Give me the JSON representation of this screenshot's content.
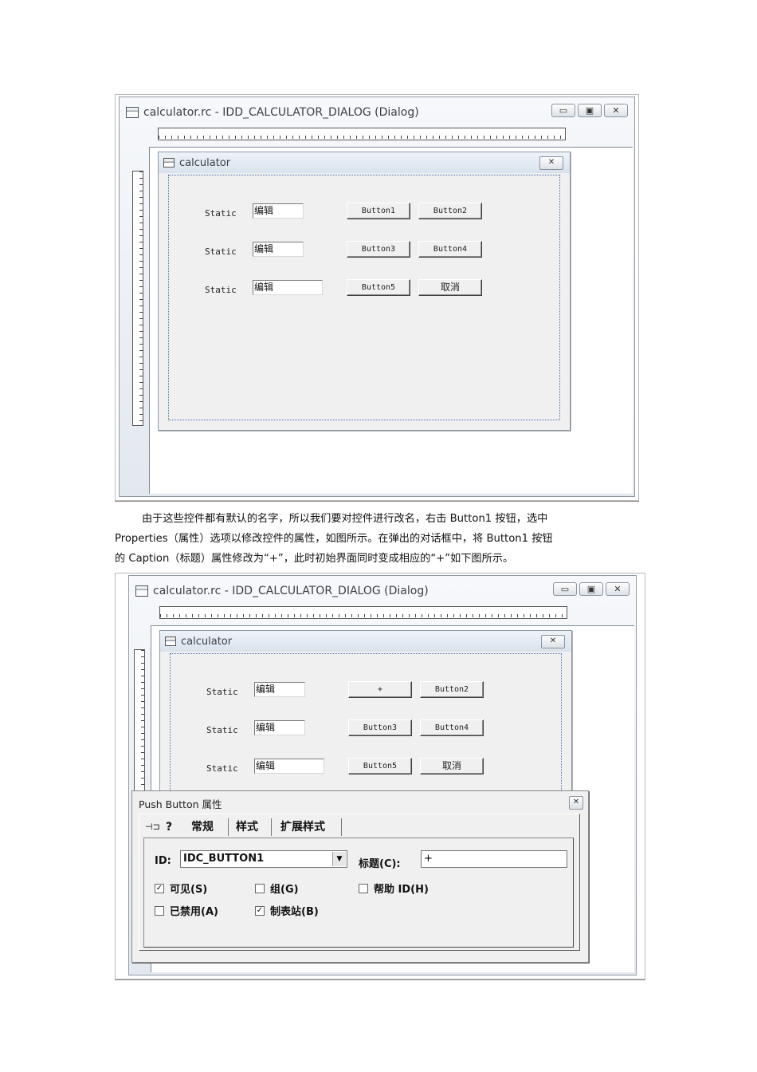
{
  "screenshot1": {
    "window_title": "calculator.rc - IDD_CALCULATOR_DIALOG (Dialog)",
    "window_buttons": {
      "minimize": "▭",
      "maximize": "▣",
      "close": "✕"
    },
    "dialog": {
      "title": "calculator",
      "close": "✕",
      "rows": [
        {
          "label": "Static",
          "edit": "编辑",
          "btn_a": "Button1",
          "btn_b": "Button2"
        },
        {
          "label": "Static",
          "edit": "编辑",
          "btn_a": "Button3",
          "btn_b": "Button4"
        },
        {
          "label": "Static",
          "edit": "编辑",
          "btn_a": "Button5",
          "btn_b": "取消"
        }
      ]
    }
  },
  "paragraph": [
    "由于这些控件都有默认的名字，所以我们要对控件进行改名，右击 Button1 按钮，选中",
    "Properties（属性）选项以修改控件的属性，如图所示。在弹出的对话框中，将 Button1 按钮",
    "的 Caption（标题）属性修改为“+”，此时初始界面同时变成相应的“+”如下图所示。"
  ],
  "screenshot2": {
    "window_title": "calculator.rc - IDD_CALCULATOR_DIALOG (Dialog)",
    "window_buttons": {
      "minimize": "▭",
      "maximize": "▣",
      "close": "✕"
    },
    "dialog": {
      "title": "calculator",
      "close": "✕",
      "rows": [
        {
          "label": "Static",
          "edit": "编辑",
          "btn_a": "+",
          "btn_b": "Button2"
        },
        {
          "label": "Static",
          "edit": "编辑",
          "btn_a": "Button3",
          "btn_b": "Button4"
        },
        {
          "label": "Static",
          "edit": "编辑",
          "btn_a": "Button5",
          "btn_b": "取消"
        }
      ]
    },
    "properties": {
      "title": "Push Button 属性",
      "close": "✕",
      "pin_icon": "⊣⊐",
      "help_icon": "?",
      "tabs": [
        "常规",
        "样式",
        "扩展样式"
      ],
      "id_label": "ID:",
      "id_value": "IDC_BUTTON1",
      "caption_label": "标题(C):",
      "caption_value": "+",
      "checkboxes": [
        {
          "label": "可见(S)",
          "checked": true
        },
        {
          "label": "组(G)",
          "checked": false
        },
        {
          "label": "帮助 ID(H)",
          "checked": false
        },
        {
          "label": "已禁用(A)",
          "checked": false
        },
        {
          "label": "制表站(B)",
          "checked": true
        }
      ],
      "check_mark": "✓"
    }
  }
}
